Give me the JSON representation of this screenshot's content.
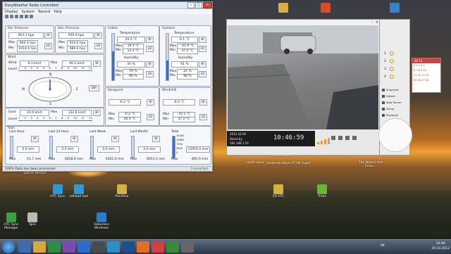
{
  "desktop": {
    "icons": [
      {
        "label": "",
        "color": "#d8b240"
      },
      {
        "label": "",
        "color": "#d94a2a"
      },
      {
        "label": "",
        "color": "#3a80d0"
      },
      {
        "label": "",
        "color": "#d8b240"
      },
      {
        "label": "Jezdemie Store",
        "color": "#3a5f9a"
      },
      {
        "label": "TP OR kupni",
        "color": "#d8b240"
      },
      {
        "label": "The Naked And Famo...",
        "color": "#3b3b3b"
      },
      {
        "label": "HTC Sync",
        "color": "#6bb43a"
      },
      {
        "label": "sdhead aws",
        "color": "#2c9ad8"
      },
      {
        "label": "Ponmiso",
        "color": "#d8b240"
      },
      {
        "label": "5D HTC",
        "color": "#d8b240"
      },
      {
        "label": "Trees",
        "color": "#6bb43a"
      },
      {
        "label": "HTC Sync Manager",
        "color": "#3aa040"
      },
      {
        "label": "Spin",
        "color": "#999999"
      },
      {
        "label": "Dokumen Windows",
        "color": "#2d7ad0"
      }
    ],
    "top_labels": {
      "left": "Software",
      "right": "Dorne Version",
      "obas": "rozdii obas"
    }
  },
  "weather": {
    "title": "EasyWeather Radio Controlled",
    "menu": [
      "Display",
      "System",
      "Record",
      "Help"
    ],
    "rel_pressure": {
      "title": "Rel. Pressure",
      "value": "963.1 hpa",
      "max_label": "Max",
      "max": "969.3 hpa",
      "min_label": "Min",
      "min": "1014.4 hpa"
    },
    "abs_pressure": {
      "title": "Abs. Pressure",
      "value": "949.4 hpa",
      "max_label": "Max",
      "max": "924.6 hpa",
      "min_label": "Min",
      "min": "989.6 hpa"
    },
    "indoor": {
      "title": "Indoor",
      "temp_title": "Temperature",
      "temp": "20.5 °C",
      "max": "19.3 °C",
      "min": "13.3 °C",
      "hum_title": "Humidity",
      "hum": "34 %",
      "hmax": "19 %",
      "hmin": "89 %",
      "scale": [
        "60",
        "50",
        "40",
        "30",
        "20",
        "10",
        "0",
        "-10",
        "-20",
        "-30",
        "-40"
      ]
    },
    "outdoor": {
      "title": "Outdoor",
      "temp_title": "Temperature",
      "temp": "0.1 °C",
      "max": "-25.9 °C",
      "min": "37.2 °C",
      "hum_title": "Humidity",
      "hum": "91 %",
      "hmax": "21 %",
      "hmin": "88 %",
      "scale": [
        "60",
        "50",
        "40",
        "30",
        "20",
        "10",
        "0",
        "-10",
        "-20",
        "-30",
        "-40"
      ]
    },
    "wind": {
      "title": "Wind",
      "wind_label": "Wind",
      "value": "9.3 km/t",
      "max_label": "Max",
      "max": "46.2 km/t",
      "level_label": "Level",
      "dir_label": "DIR",
      "compass": [
        "N",
        "E",
        "S",
        "W"
      ],
      "scale": [
        "1",
        "2",
        "3",
        "4",
        "5",
        "6",
        "7",
        "8",
        "9",
        "10",
        "11",
        "12"
      ]
    },
    "gust": {
      "label": "Gust",
      "value": "14.6 km/t",
      "max_label": "Max",
      "max": "122.8 km/t",
      "level_label": "Level"
    },
    "dewpoint": {
      "title": "Dewpoint",
      "value": "-6.2 °C",
      "max": "-0.2 °C",
      "min": "26.4 °C"
    },
    "windchill": {
      "title": "Windchill",
      "value": "-6.0 °C",
      "max": "-32.1 °C",
      "min": "37.2 °C"
    },
    "rain": {
      "title": "Rain",
      "cols": [
        {
          "title": "Last Hour",
          "val": "0.0 mm",
          "max": "41.7 mm"
        },
        {
          "title": "Last 24 Hour",
          "val": "0.0 mm",
          "max": "6628.6 mm"
        },
        {
          "title": "Last Week",
          "val": "0.0 mm",
          "max": "6501.6 mm"
        },
        {
          "title": "Last Month",
          "val": "0.0 mm",
          "max": "6651.5 mm"
        }
      ],
      "total": {
        "title": "Total",
        "scale": [
          "14400",
          "10800",
          "7200",
          "3600",
          "0"
        ],
        "value": "13974.0 mm",
        "max": "891.9 mm"
      }
    },
    "hi": "HI",
    "lo": "LO",
    "max": "Max",
    "min": "Min",
    "status": "100% Data has been processed.",
    "status_right": "Connected"
  },
  "camera": {
    "date": "2012.10.29",
    "stand": "Stand by",
    "ip": "192.168.1.10",
    "time": "10:46:59",
    "menu": [
      "Snapshot",
      "Detect",
      "Web Server",
      "Setup",
      "Playback"
    ],
    "channels": [
      "1",
      "2",
      "3",
      "4"
    ]
  },
  "calendar": {
    "header": "30 12",
    "rows": [
      "1 2 3 4 5",
      "6 7 8 9 10",
      "11 12 13 14",
      "15 16 17 18"
    ]
  },
  "taskbar": {
    "time": "10:46",
    "date": "29.10.2012",
    "lang": "SK"
  }
}
